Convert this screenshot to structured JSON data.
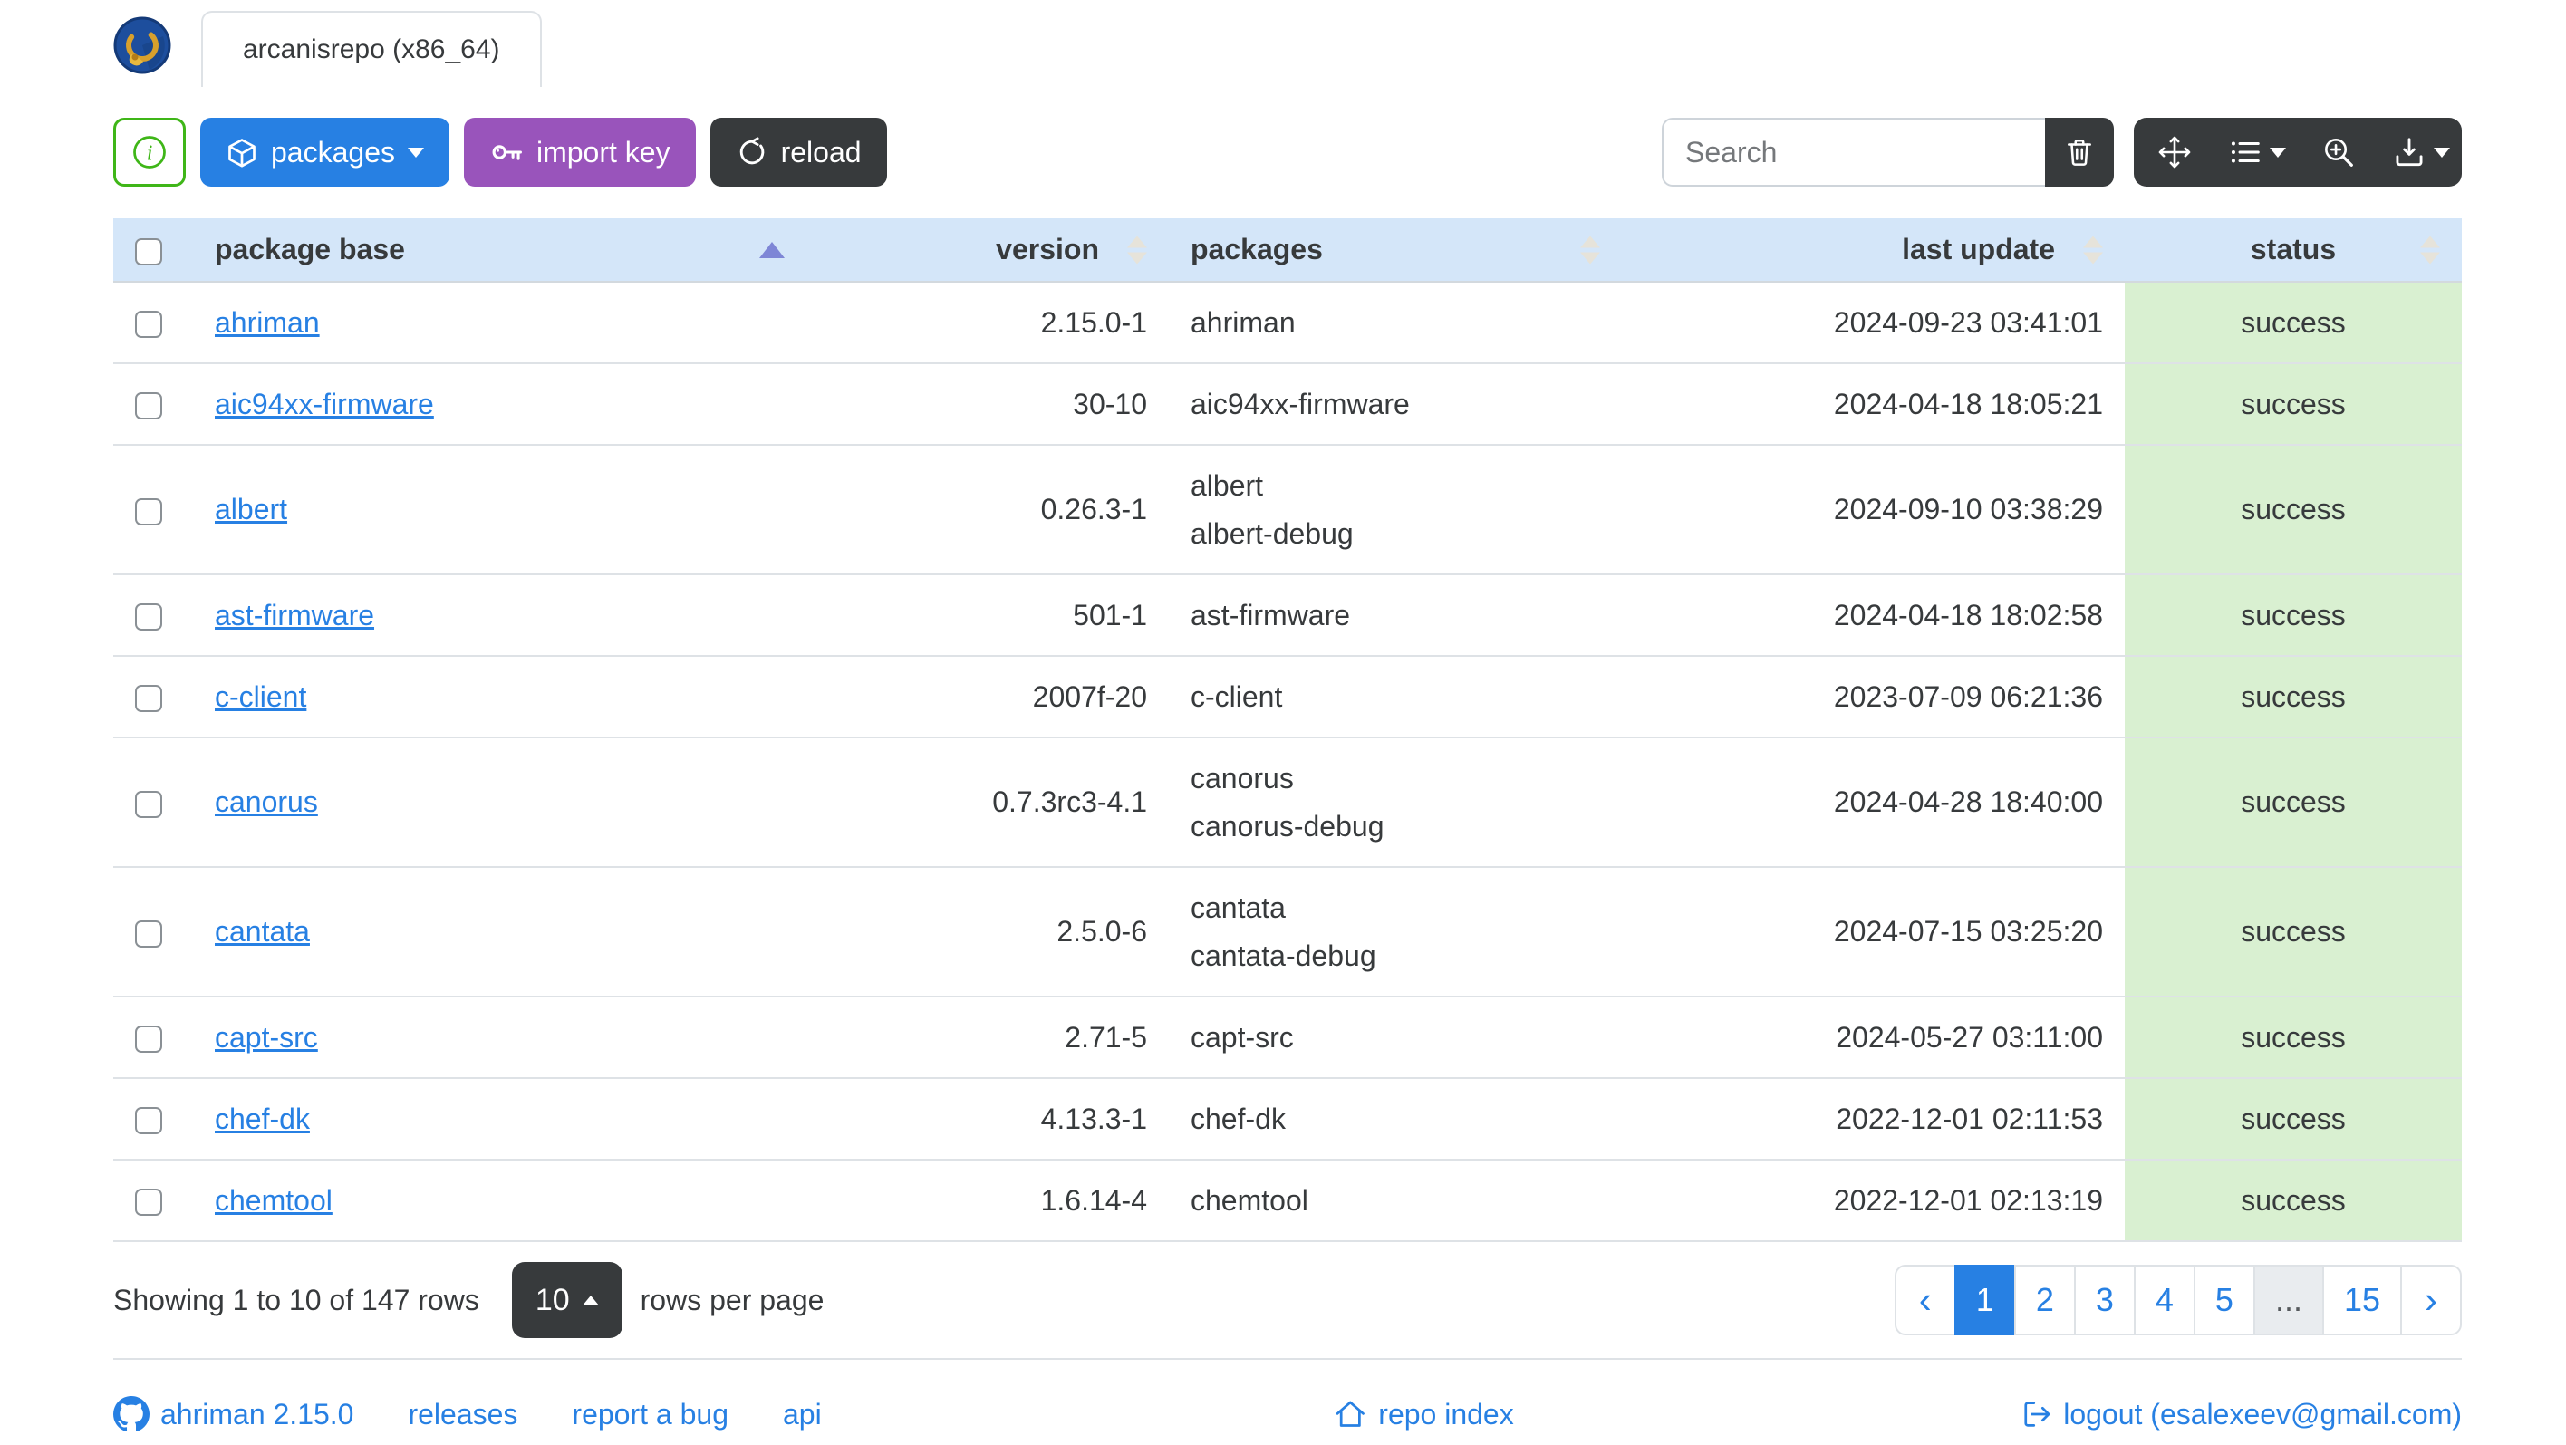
{
  "colors": {
    "primary": "#2780e3",
    "purple": "#9954bb",
    "dark": "#373a3c",
    "success": "#3fb618",
    "header_bg": "#d4e6f9",
    "status_success_bg": "#d9f0d1",
    "border": "#dee2e6",
    "sort_active_arrow": "#7e86d6"
  },
  "header": {
    "logo_icon": "ahriman-repo-logo",
    "tab_label": "arcanisrepo (x86_64)"
  },
  "toolbar": {
    "info_button": {
      "icon": "info-circle-icon"
    },
    "packages_button": {
      "label": "packages",
      "icon": "box-icon",
      "caret": "caret-down"
    },
    "import_key_button": {
      "label": "import key",
      "icon": "key-icon"
    },
    "reload_button": {
      "label": "reload",
      "icon": "arrow-clockwise-icon"
    },
    "search": {
      "placeholder": "Search"
    },
    "trash_button": {
      "icon": "trash-icon"
    },
    "icon_buttons": [
      {
        "name": "fullscreen-button",
        "icon": "arrows-move-icon",
        "caret": false
      },
      {
        "name": "columns-button",
        "icon": "list-ul-icon",
        "caret": true
      },
      {
        "name": "zoom-button",
        "icon": "zoom-in-icon",
        "caret": false
      },
      {
        "name": "export-button",
        "icon": "download-icon",
        "caret": true
      }
    ]
  },
  "table": {
    "columns": [
      {
        "label": "",
        "key": "select",
        "sort": "none"
      },
      {
        "label": "package base",
        "key": "base",
        "sort": "asc",
        "align": "al"
      },
      {
        "label": "version",
        "key": "version",
        "sort": "both",
        "align": "ar"
      },
      {
        "label": "packages",
        "key": "packages",
        "sort": "both",
        "align": "al"
      },
      {
        "label": "last update",
        "key": "last_update",
        "sort": "both",
        "align": "ar"
      },
      {
        "label": "status",
        "key": "status",
        "sort": "both",
        "align": "ac"
      }
    ],
    "rows": [
      {
        "base": "ahriman",
        "version": "2.15.0-1",
        "packages": [
          "ahriman"
        ],
        "last_update": "2024-09-23 03:41:01",
        "status": "success"
      },
      {
        "base": "aic94xx-firmware",
        "version": "30-10",
        "packages": [
          "aic94xx-firmware"
        ],
        "last_update": "2024-04-18 18:05:21",
        "status": "success"
      },
      {
        "base": "albert",
        "version": "0.26.3-1",
        "packages": [
          "albert",
          "albert-debug"
        ],
        "last_update": "2024-09-10 03:38:29",
        "status": "success"
      },
      {
        "base": "ast-firmware",
        "version": "501-1",
        "packages": [
          "ast-firmware"
        ],
        "last_update": "2024-04-18 18:02:58",
        "status": "success"
      },
      {
        "base": "c-client",
        "version": "2007f-20",
        "packages": [
          "c-client"
        ],
        "last_update": "2023-07-09 06:21:36",
        "status": "success"
      },
      {
        "base": "canorus",
        "version": "0.7.3rc3-4.1",
        "packages": [
          "canorus",
          "canorus-debug"
        ],
        "last_update": "2024-04-28 18:40:00",
        "status": "success"
      },
      {
        "base": "cantata",
        "version": "2.5.0-6",
        "packages": [
          "cantata",
          "cantata-debug"
        ],
        "last_update": "2024-07-15 03:25:20",
        "status": "success"
      },
      {
        "base": "capt-src",
        "version": "2.71-5",
        "packages": [
          "capt-src"
        ],
        "last_update": "2024-05-27 03:11:00",
        "status": "success"
      },
      {
        "base": "chef-dk",
        "version": "4.13.3-1",
        "packages": [
          "chef-dk"
        ],
        "last_update": "2022-12-01 02:11:53",
        "status": "success"
      },
      {
        "base": "chemtool",
        "version": "1.6.14-4",
        "packages": [
          "chemtool"
        ],
        "last_update": "2022-12-01 02:13:19",
        "status": "success"
      }
    ]
  },
  "pagination": {
    "summary": "Showing 1 to 10 of 147 rows",
    "page_size": "10",
    "rows_per_page_label": "rows per page",
    "items": [
      {
        "label": "‹",
        "type": "prev"
      },
      {
        "label": "1",
        "type": "page",
        "active": true
      },
      {
        "label": "2",
        "type": "page"
      },
      {
        "label": "3",
        "type": "page"
      },
      {
        "label": "4",
        "type": "page"
      },
      {
        "label": "5",
        "type": "page"
      },
      {
        "label": "...",
        "type": "ellipsis"
      },
      {
        "label": "15",
        "type": "page"
      },
      {
        "label": "›",
        "type": "next"
      }
    ]
  },
  "footer": {
    "left_links": [
      {
        "label": "ahriman 2.15.0",
        "icon": "github-icon"
      },
      {
        "label": "releases",
        "icon": null
      },
      {
        "label": "report a bug",
        "icon": null
      },
      {
        "label": "api",
        "icon": null
      }
    ],
    "center_link": {
      "label": "repo index",
      "icon": "house-icon"
    },
    "right_link": {
      "label": "logout (esalexeev@gmail.com)",
      "icon": "logout-icon"
    }
  }
}
